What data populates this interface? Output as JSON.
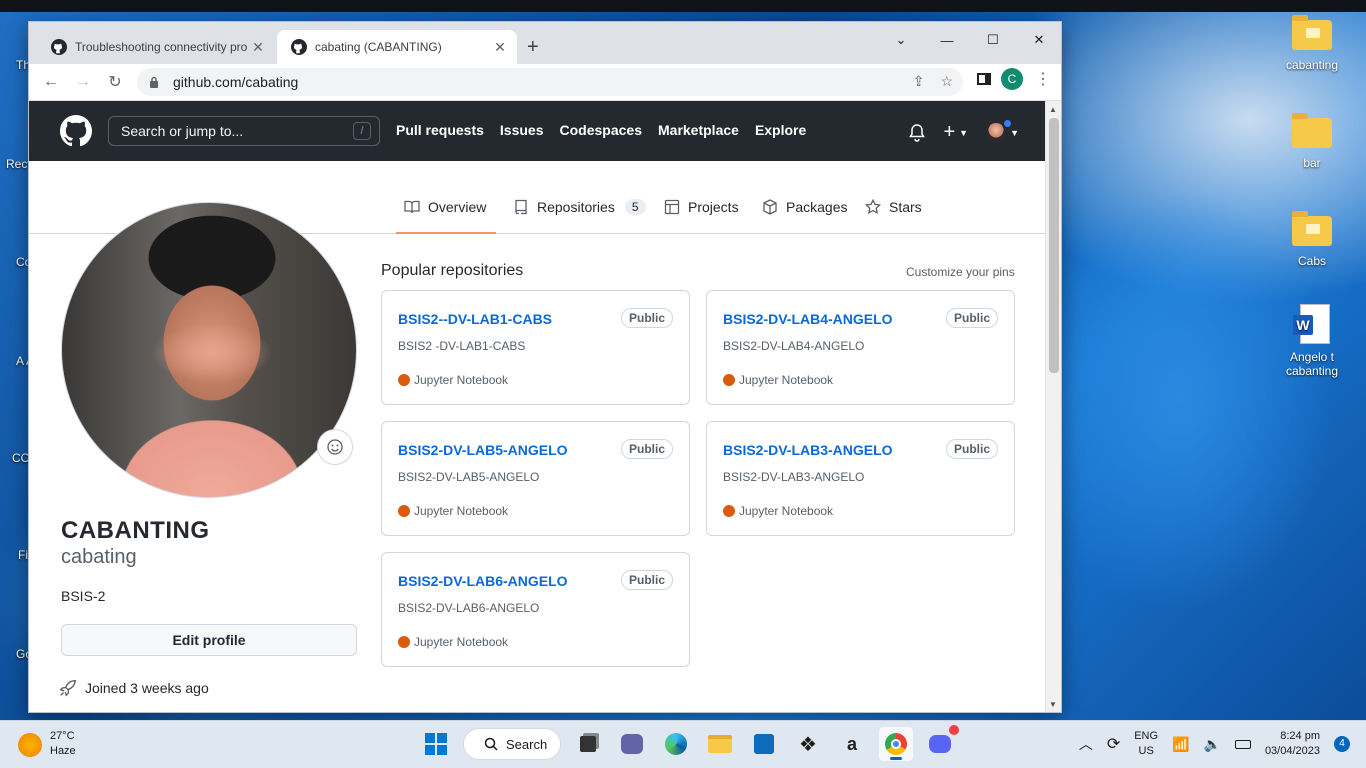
{
  "browser": {
    "tabs": [
      {
        "title": "Troubleshooting connectivity pro",
        "active": false
      },
      {
        "title": "cabating (CABANTING)",
        "active": true
      }
    ],
    "url": "github.com/cabating",
    "profile_initial": "C"
  },
  "github": {
    "search_placeholder": "Search or jump to...",
    "search_shortcut": "/",
    "nav": [
      "Pull requests",
      "Issues",
      "Codespaces",
      "Marketplace",
      "Explore"
    ],
    "plus": "+"
  },
  "profile_tabs": {
    "overview": "Overview",
    "repositories": "Repositories",
    "repositories_count": "5",
    "projects": "Projects",
    "packages": "Packages",
    "stars": "Stars"
  },
  "profile": {
    "full_name": "CABANTING",
    "username": "cabating",
    "bio": "BSIS-2",
    "edit_button": "Edit profile",
    "joined": "Joined 3 weeks ago"
  },
  "popular": {
    "title": "Popular repositories",
    "customize": "Customize your pins",
    "repos": [
      {
        "name": "BSIS2--DV-LAB1-CABS",
        "visibility": "Public",
        "desc": "BSIS2 -DV-LAB1-CABS",
        "lang": "Jupyter Notebook"
      },
      {
        "name": "BSIS2-DV-LAB4-ANGELO",
        "visibility": "Public",
        "desc": "BSIS2-DV-LAB4-ANGELO",
        "lang": "Jupyter Notebook"
      },
      {
        "name": "BSIS2-DV-LAB5-ANGELO",
        "visibility": "Public",
        "desc": "BSIS2-DV-LAB5-ANGELO",
        "lang": "Jupyter Notebook"
      },
      {
        "name": "BSIS2-DV-LAB3-ANGELO",
        "visibility": "Public",
        "desc": "BSIS2-DV-LAB3-ANGELO",
        "lang": "Jupyter Notebook"
      },
      {
        "name": "BSIS2-DV-LAB6-ANGELO",
        "visibility": "Public",
        "desc": "BSIS2-DV-LAB6-ANGELO",
        "lang": "Jupyter Notebook"
      }
    ],
    "lang_color": "#da5b0b"
  },
  "desktop": {
    "icons": [
      {
        "label": "cabanting"
      },
      {
        "label": "bar"
      },
      {
        "label": "Cabs"
      },
      {
        "label": "Angelo t cabanting"
      }
    ],
    "left_fragments": [
      "Th",
      "Recy",
      "Co P",
      "A Ac",
      "CO",
      "Fi",
      "Go Ch"
    ]
  },
  "taskbar": {
    "temp": "27°C",
    "condition": "Haze",
    "search": "Search",
    "lang_top": "ENG",
    "lang_bottom": "US",
    "time": "8:24 pm",
    "date": "03/04/2023",
    "notifications": "4"
  }
}
